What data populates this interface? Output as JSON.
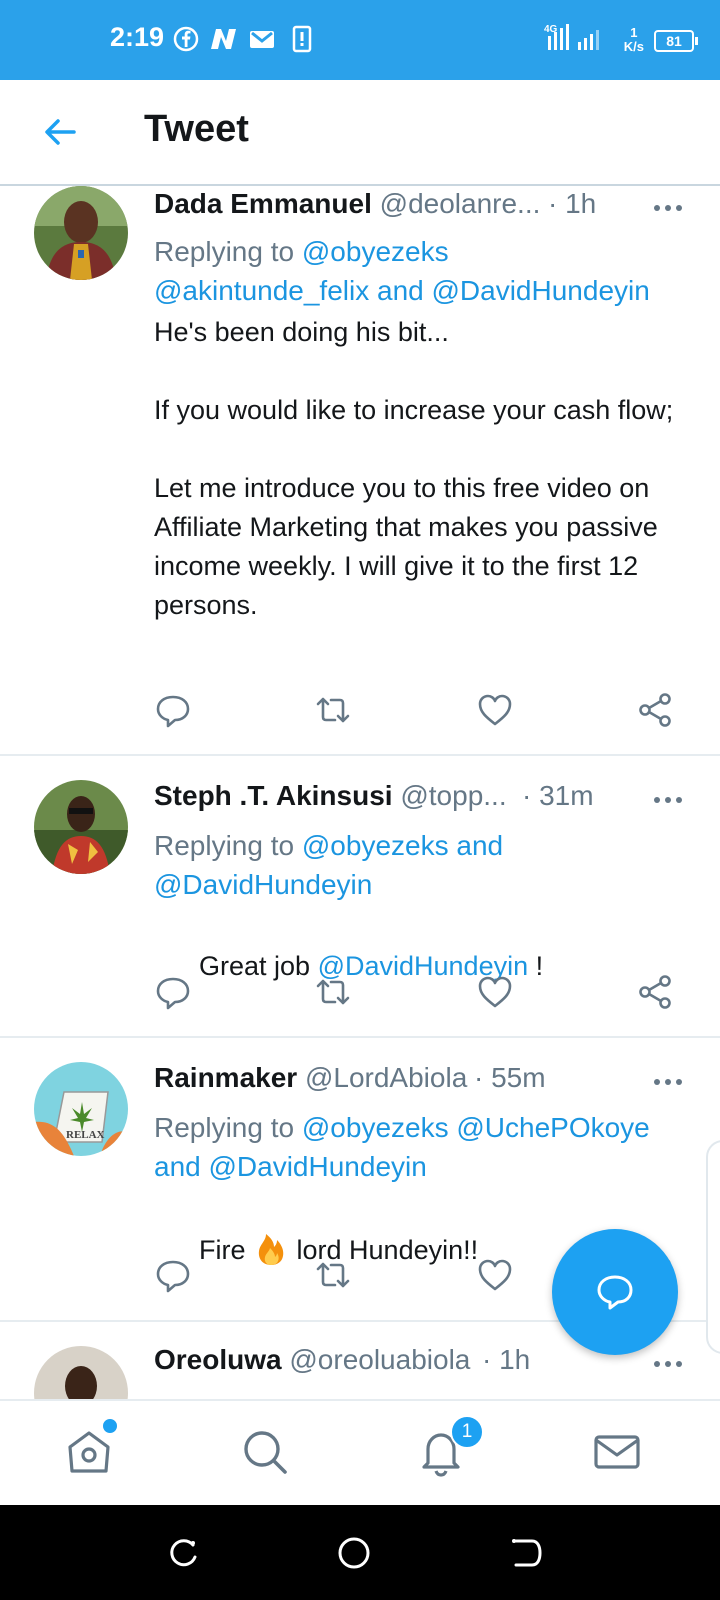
{
  "status_bar": {
    "time": "2:19",
    "network": "4G",
    "speed_value": "1",
    "speed_unit": "K/s",
    "battery": "81"
  },
  "header": {
    "title": "Tweet"
  },
  "tweets": [
    {
      "name": "Dada Emmanuel",
      "handle": "@deolanre...",
      "time": "· 1h",
      "replying_prefix": "Replying to ",
      "replying_to": "@obyezeks",
      "replying_line2": "@akintunde_felix and @DavidHundeyin",
      "text": "He's been doing his bit...\n\nIf you would like to increase your cash flow;\n\nLet me introduce you to this free video on Affiliate Marketing that makes you passive income weekly. I will give it to the first 12 persons."
    },
    {
      "name": "Steph .T. Akinsusi",
      "handle": "@topp...",
      "time": "· 31m",
      "replying_prefix": "Replying to ",
      "replying_to": "@obyezeks and",
      "replying_line2": "@DavidHundeyin",
      "text_pre": "Great job ",
      "text_mention": "@DavidHundeyin",
      "text_post": " !"
    },
    {
      "name": "Rainmaker",
      "handle": "@LordAbiola",
      "time": "· 55m",
      "replying_prefix": "Replying to ",
      "replying_to": "@obyezeks @UchePOkoye",
      "replying_line2": "and @DavidHundeyin",
      "text_pre": "Fire ",
      "text_post": " lord Hundeyin!!"
    },
    {
      "name": "Oreoluwa",
      "handle": "@oreoluabiola",
      "time": "· 1h"
    }
  ],
  "bottom_nav": {
    "notifications_badge": "1"
  },
  "colors": {
    "accent": "#1da1f2",
    "status_bar": "#2ba1ea",
    "muted": "#657786"
  }
}
